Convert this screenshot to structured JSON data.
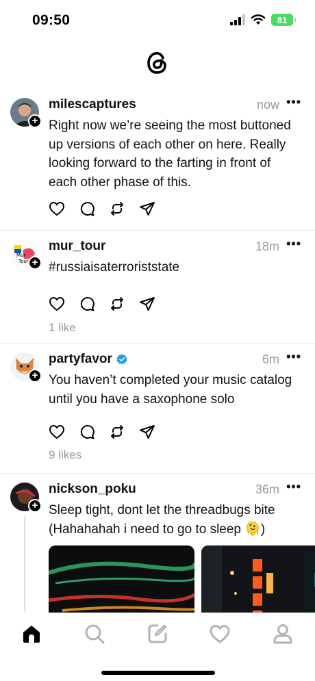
{
  "status_bar": {
    "time": "09:50",
    "battery": "81",
    "icons": [
      "signal-icon",
      "wifi-icon",
      "battery-icon"
    ]
  },
  "app": {
    "logo": "threads-logo-icon"
  },
  "posts": [
    {
      "username": "milescaptures",
      "time": "now",
      "text": "Right now we’re seeing the most buttoned up versions of each other on here. Really looking forward to the farting in front of each other phase of this.",
      "likes": "",
      "verified": false
    },
    {
      "username": "mur_tour",
      "time": "18m",
      "text": "#russiaisaterroriststate",
      "likes": "1 like",
      "verified": false
    },
    {
      "username": "partyfavor",
      "time": "6m",
      "text": "You haven’t completed your music catalog until you have a saxophone solo",
      "likes": "9 likes",
      "verified": true
    },
    {
      "username": "nickson_poku",
      "time": "36m",
      "text": "Sleep tight, dont let the threadbugs bite (Hahahahah i need to go to sleep 🫠)",
      "likes": "",
      "verified": false
    }
  ],
  "post_action_icons": [
    "heart-icon",
    "comment-icon",
    "repost-icon",
    "share-icon"
  ],
  "nav": [
    "home-icon",
    "search-icon",
    "compose-icon",
    "activity-heart-icon",
    "profile-icon"
  ],
  "colors": {
    "accent": "#000000",
    "muted": "#999999",
    "verified": "#1d9bf0",
    "battery": "#4cd964",
    "divider": "#e6e6e6"
  }
}
